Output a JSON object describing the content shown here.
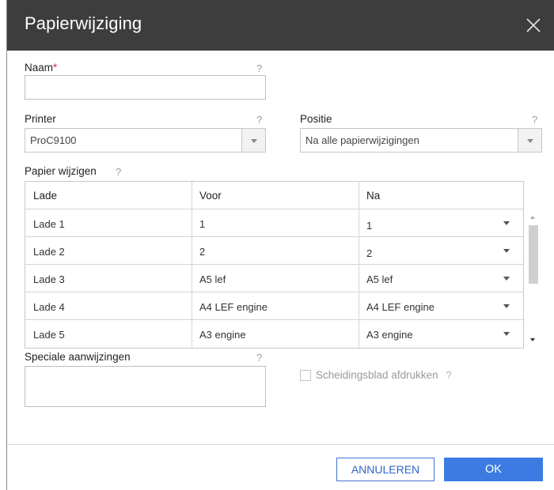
{
  "dialog": {
    "title": "Papierwijziging",
    "close_icon": "close-icon"
  },
  "form": {
    "name_label": "Naam",
    "name_required_mark": "*",
    "name_value": "",
    "help_mark": "?",
    "printer_label": "Printer",
    "printer_value": "ProC9100",
    "position_label": "Positie",
    "position_value": "Na alle papierwijzigingen",
    "change_paper_label": "Papier wijzigen",
    "special_instructions_label": "Speciale aanwijzingen",
    "special_instructions_value": "",
    "separator_sheet_label": "Scheidingsblad afdrukken",
    "separator_sheet_checked": false
  },
  "table": {
    "headers": [
      "Lade",
      "Voor",
      "Na"
    ],
    "rows": [
      {
        "tray": "Lade 1",
        "before": "1",
        "after": "1"
      },
      {
        "tray": "Lade 2",
        "before": "2",
        "after": "2"
      },
      {
        "tray": "Lade 3",
        "before": "A5 lef",
        "after": "A5 lef"
      },
      {
        "tray": "Lade 4",
        "before": "A4 LEF engine",
        "after": "A4 LEF engine"
      },
      {
        "tray": "Lade 5",
        "before": "A3 engine",
        "after": "A3 engine"
      }
    ]
  },
  "footer": {
    "cancel_label": "ANNULEREN",
    "ok_label": "OK"
  },
  "colors": {
    "titlebar": "#3d3d3d",
    "accent": "#3c7ce2",
    "required": "#e21c3a"
  }
}
